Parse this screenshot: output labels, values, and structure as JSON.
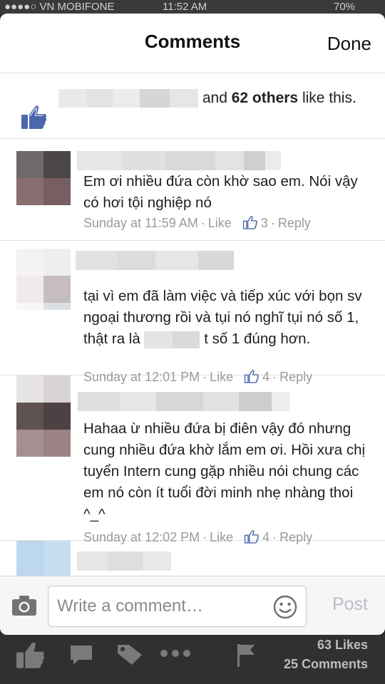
{
  "status_bar": {
    "carrier": "●●●●○ VN MOBIFONE",
    "time": "11:52 AM",
    "battery": "70%"
  },
  "header": {
    "title": "Comments",
    "done_label": "Done"
  },
  "likes_summary": {
    "and": "and",
    "others": "62 others",
    "tail": "like this."
  },
  "comments": [
    {
      "text": "Em ơi nhiều đứa còn khờ sao em. Nói vậy có hơi tội nghiệp nó",
      "time": "Sunday at 11:59 AM",
      "like_label": "Like",
      "like_count": "3",
      "reply_label": "Reply"
    },
    {
      "text_before": "tại vì em đã làm việc và tiếp xúc với bọn sv ngoại thương rồi và tụi nó nghĩ tụi nó số 1, thật ra là",
      "text_after": "t số 1 đúng hơn.",
      "time": "Sunday at 12:01 PM",
      "like_label": "Like",
      "like_count": "4",
      "reply_label": "Reply"
    },
    {
      "text": "Hahaa ừ nhiều đứa bị điên vậy đó nhưng cung nhiều đứa khờ lắm em ơi. Hồi xưa chị tuyển Intern cung gặp nhiều nói chung các em nó còn ít tuổi đời minh nhẹ nhàng thoi ^_^",
      "time": "Sunday at 12:02 PM",
      "like_label": "Like",
      "like_count": "4",
      "reply_label": "Reply"
    }
  ],
  "composer": {
    "placeholder": "Write a comment…",
    "post_label": "Post"
  },
  "footer": {
    "likes": "63 Likes",
    "comments": "25 Comments"
  },
  "icons": [
    "like-thumb-icon",
    "camera-icon",
    "smiley-icon",
    "chat-bubble-icon",
    "tag-icon",
    "more-dots-icon",
    "flag-icon"
  ],
  "colors": {
    "accent_blue": "#4a67ad",
    "meta_gray": "#9a9a9a",
    "post_disabled": "#b9bdc6"
  }
}
